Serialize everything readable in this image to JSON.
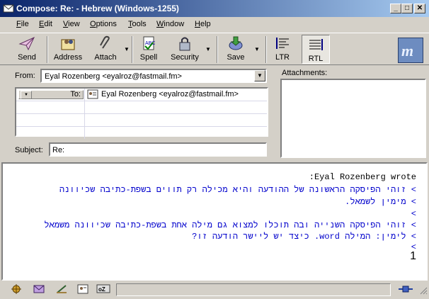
{
  "window": {
    "title": "Compose: Re:  - Hebrew (Windows-1255)",
    "minimize": "_",
    "maximize": "□",
    "close": "✕"
  },
  "menu": [
    {
      "label": "File",
      "key": "F",
      "rest": "ile"
    },
    {
      "label": "Edit",
      "key": "E",
      "rest": "dit"
    },
    {
      "label": "View",
      "key": "V",
      "rest": "iew"
    },
    {
      "label": "Options",
      "key": "O",
      "rest": "ptions"
    },
    {
      "label": "Tools",
      "key": "T",
      "rest": "ools"
    },
    {
      "label": "Window",
      "key": "W",
      "rest": "indow"
    },
    {
      "label": "Help",
      "key": "H",
      "rest": "elp"
    }
  ],
  "toolbar": {
    "send": "Send",
    "address": "Address",
    "attach": "Attach",
    "spell": "Spell",
    "security": "Security",
    "save": "Save",
    "ltr": "LTR",
    "rtl": "RTL",
    "dropdown_arrow": "▼"
  },
  "compose": {
    "from_label": "From:",
    "from_value": "Eyal Rozenberg <eyalroz@fastmail.fm>",
    "recipient_type": "To:",
    "recipient_value": "Eyal Rozenberg <eyalroz@fastmail.fm>",
    "subject_label": "Subject:",
    "subject_value": "Re:",
    "attachments_label": "Attachments:"
  },
  "body": {
    "lines": [
      {
        "text": "Eyal Rozenberg wrote:",
        "color": "#000000"
      },
      {
        "text": "> זוהי הפיסקה הראשונה של ההודעה והיא מכילה רק תווים בשפת-כתיבה שכיוונה",
        "color": "#0000cc"
      },
      {
        "text": "> מימין לשמאל.",
        "color": "#0000cc"
      },
      {
        "text": ">",
        "color": "#0000cc"
      },
      {
        "text": "> זוהי הפיסקה השנייה ובה תוכלו למצוא גם מילה אחת בשפת-כתיבה שכיוונה משמאל",
        "color": "#0000cc"
      },
      {
        "text": "> לימין: המילה word. כיצד יש ליישר הודעה זו?",
        "color": "#0000cc"
      },
      {
        "text": ">",
        "color": "#0000cc"
      },
      {
        "text": "1",
        "color": "#000000"
      }
    ]
  },
  "colors": {
    "title_start": "#0a246a",
    "title_end": "#a6caf0",
    "quote": "#0000cc",
    "chrome": "#d4d0c8"
  }
}
